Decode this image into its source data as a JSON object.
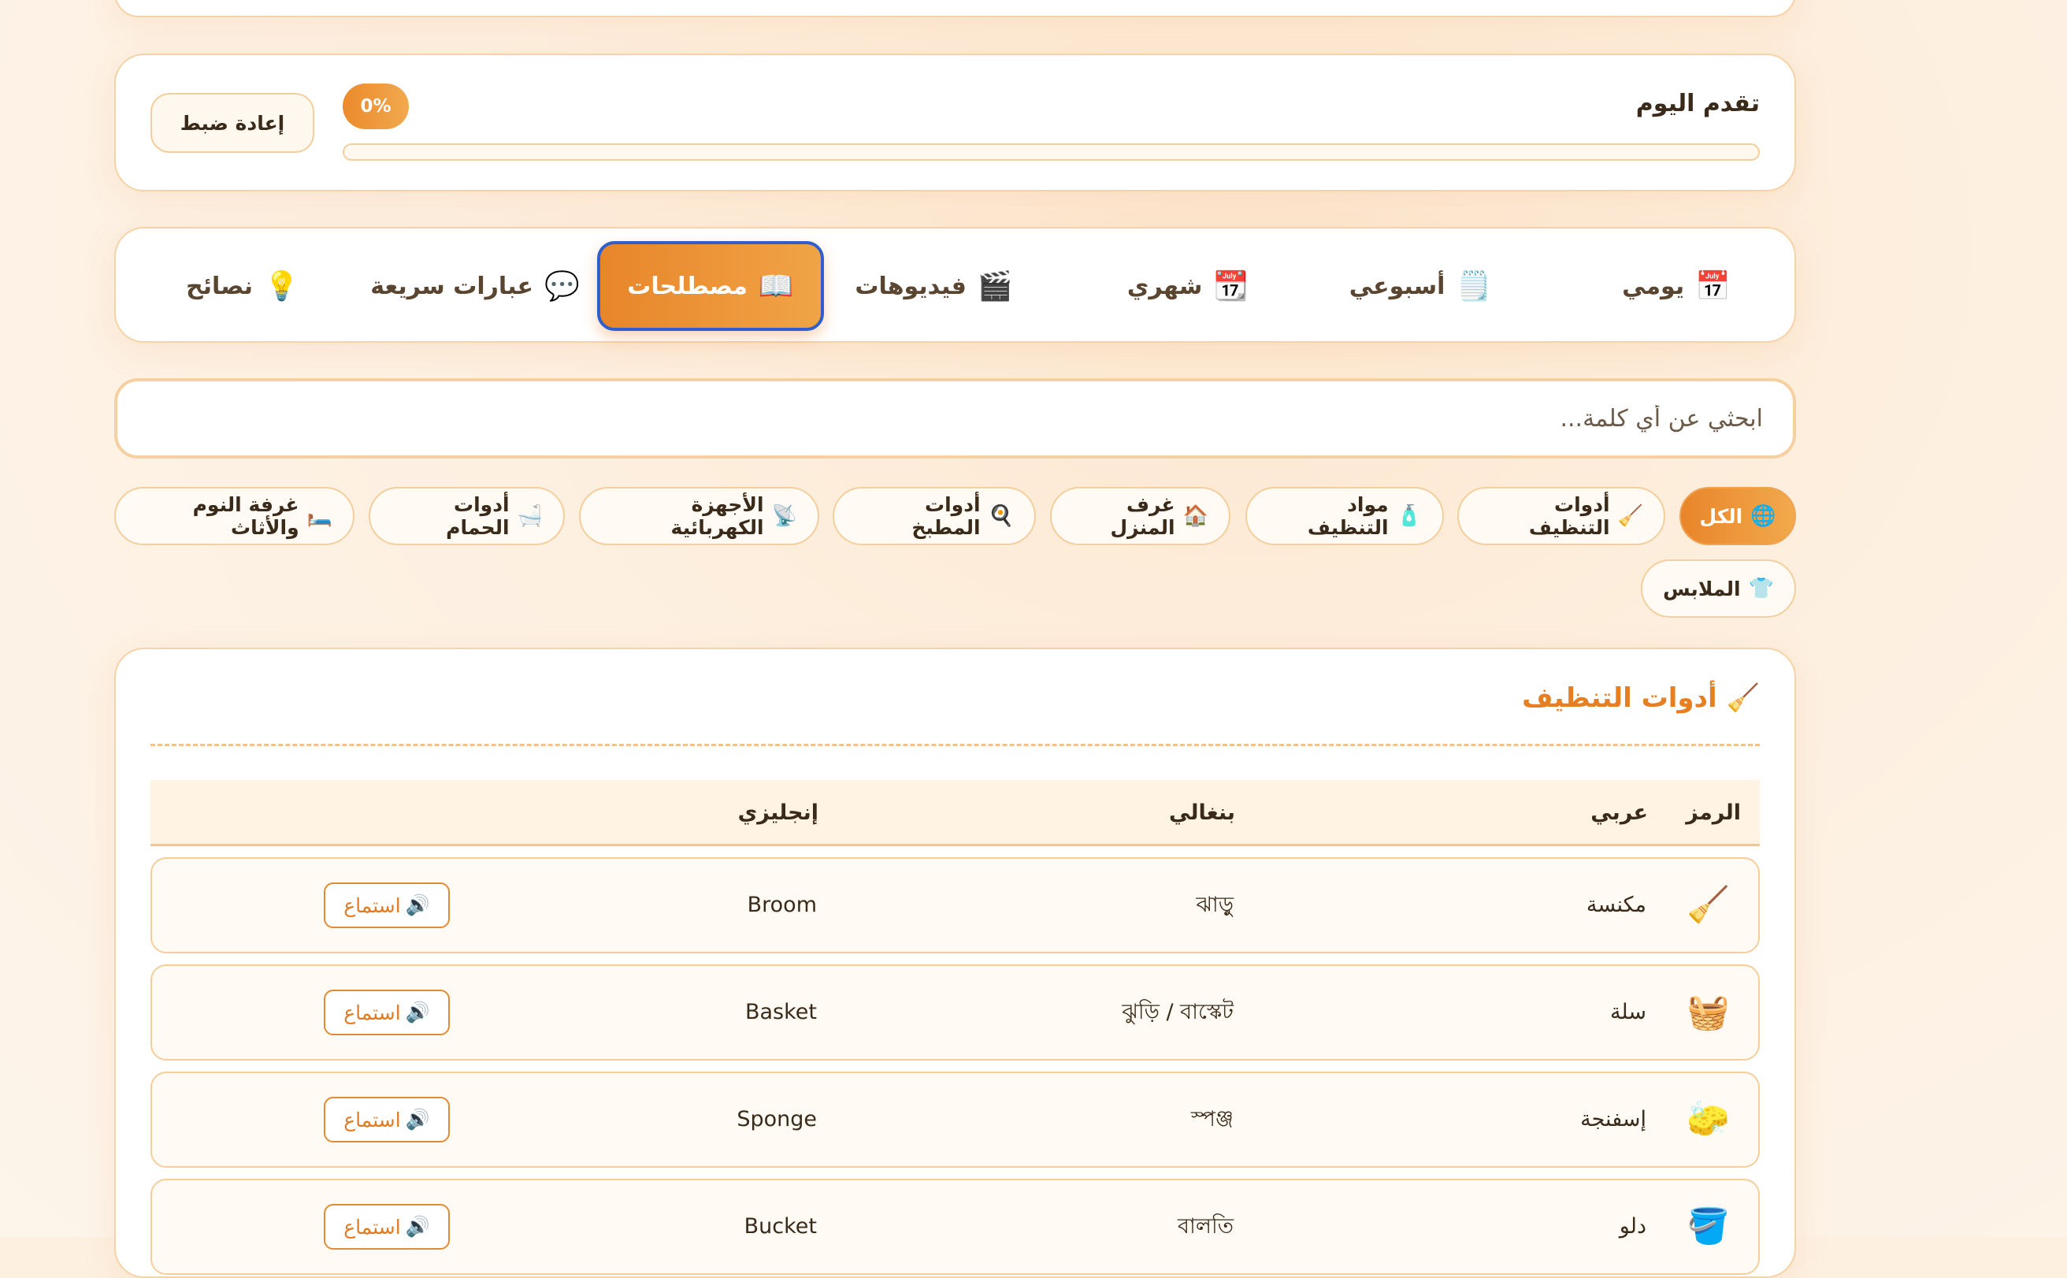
{
  "progress": {
    "title": "تقدم اليوم",
    "percent_label": "0%",
    "percent": 0,
    "reset_label": "إعادة ضبط"
  },
  "tabs": [
    {
      "icon": "📅",
      "label": "يومي"
    },
    {
      "icon": "🗒️",
      "label": "أسبوعي"
    },
    {
      "icon": "📆",
      "label": "شهري"
    },
    {
      "icon": "🎬",
      "label": "فيديوهات"
    },
    {
      "icon": "📖",
      "label": "مصطلحات",
      "active": true
    },
    {
      "icon": "💬",
      "label": "عبارات سريعة"
    },
    {
      "icon": "💡",
      "label": "نصائح"
    }
  ],
  "search": {
    "placeholder": "ابحثي عن أي كلمة..."
  },
  "categories": [
    {
      "icon": "🌐",
      "label": "الكل",
      "active": true
    },
    {
      "icon": "🧹",
      "label": "أدوات التنظيف"
    },
    {
      "icon": "🧴",
      "label": "مواد التنظيف"
    },
    {
      "icon": "🏠",
      "label": "غرف المنزل"
    },
    {
      "icon": "🍳",
      "label": "أدوات المطبخ"
    },
    {
      "icon": "📡",
      "label": "الأجهزة الكهربائية"
    },
    {
      "icon": "🛁",
      "label": "أدوات الحمام"
    },
    {
      "icon": "🛏️",
      "label": "غرفة النوم والأثاث"
    },
    {
      "icon": "👕",
      "label": "الملابس"
    }
  ],
  "section": {
    "icon": "🧹",
    "title": "أدوات التنظيف"
  },
  "table": {
    "headers": {
      "symbol": "الرمز",
      "arabic": "عربي",
      "bengali": "بنغالي",
      "english": "إنجليزي"
    },
    "listen_icon": "🔊",
    "listen_label": "استماع",
    "rows": [
      {
        "icon": "🧹",
        "arabic": "مكنسة",
        "bengali": "ঝাড়ু",
        "english": "Broom"
      },
      {
        "icon": "🧺",
        "arabic": "سلة",
        "bengali": "ঝুড়ি / বাস্কেট",
        "english": "Basket"
      },
      {
        "icon": "🧽",
        "arabic": "إسفنجة",
        "bengali": "স্পঞ্জ",
        "english": "Sponge"
      },
      {
        "icon": "🪣",
        "arabic": "دلو",
        "bengali": "বালতি",
        "english": "Bucket"
      }
    ]
  }
}
